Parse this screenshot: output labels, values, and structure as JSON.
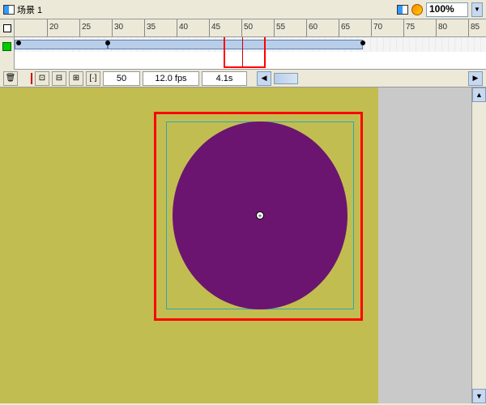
{
  "header": {
    "scene_label": "场景 1",
    "zoom": "100%"
  },
  "ruler": {
    "start": 20,
    "end": 85,
    "step": 5,
    "labels": [
      "20",
      "25",
      "30",
      "35",
      "40",
      "45",
      "50",
      "55",
      "60",
      "65",
      "70",
      "75",
      "80",
      "85"
    ]
  },
  "timeline": {
    "tween1_start": 0,
    "tween1_end": 115,
    "tween2_start": 115,
    "tween2_end": 430,
    "playhead_frame": 50
  },
  "status": {
    "frame": "50",
    "fps": "12.0 fps",
    "time": "4.1s"
  },
  "icons": {
    "trash": "🗑",
    "left": "◀",
    "right": "▶",
    "up": "▲",
    "down": "▼",
    "onion1": "⊡",
    "onion2": "⊟",
    "onion3": "⊞",
    "onion4": "[·]",
    "reg": "+"
  }
}
